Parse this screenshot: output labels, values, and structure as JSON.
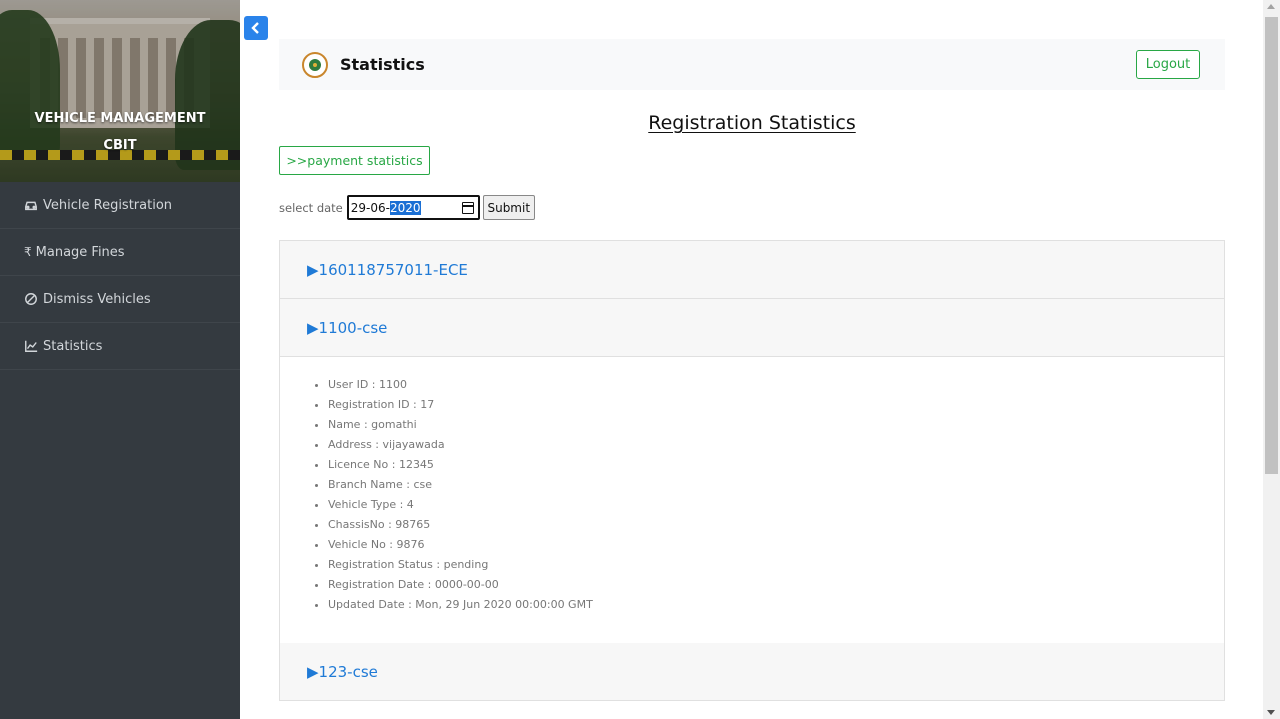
{
  "sidebar": {
    "brand_line1": "VEHICLE MANAGEMENT",
    "brand_line2": "CBIT",
    "items": [
      {
        "label": "Vehicle Registration",
        "icon": "car-icon"
      },
      {
        "label": "Manage Fines",
        "icon": "rupee-icon"
      },
      {
        "label": "Dismiss Vehicles",
        "icon": "ban-icon"
      },
      {
        "label": "Statistics",
        "icon": "line-chart-icon"
      }
    ]
  },
  "header": {
    "title": "Statistics",
    "logout_label": "Logout"
  },
  "main": {
    "page_title": "Registration Statistics",
    "payment_button": ">>payment statistics",
    "date_label": "select date",
    "date_value_prefix": "29-06-",
    "date_value_selected": "2020",
    "submit_label": "Submit",
    "records": [
      {
        "title": "▶160118757011-ECE"
      },
      {
        "title": "▶1100-cse"
      },
      {
        "title": "▶123-cse"
      }
    ],
    "details": [
      "User ID : 1100",
      "Registration ID : 17",
      "Name : gomathi",
      "Address : vijayawada",
      "Licence No : 12345",
      "Branch Name : cse",
      "Vehicle Type : 4",
      "ChassisNo : 98765",
      "Vehicle No : 9876",
      "Registration Status : pending",
      "Registration Date : 0000-00-00",
      "Updated Date : Mon, 29 Jun 2020 00:00:00 GMT"
    ]
  },
  "colors": {
    "sidebar_bg": "#343a40",
    "accent_blue": "#2a83ea",
    "link_blue": "#1f7ad6",
    "success_green": "#28a745"
  }
}
